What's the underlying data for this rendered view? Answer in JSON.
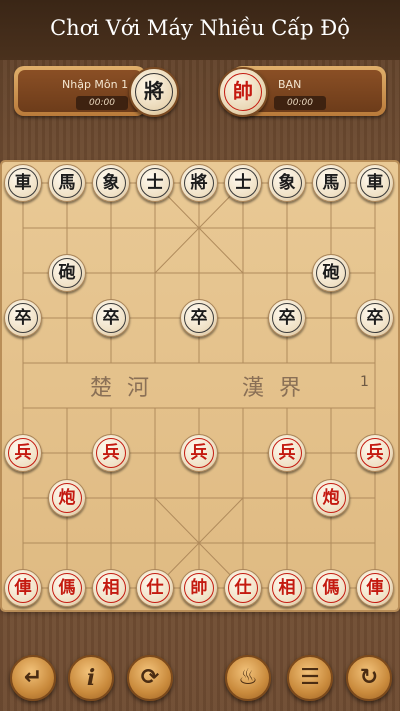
{
  "header": {
    "title": "Chơi Với Máy Nhiều Cấp Độ"
  },
  "opponent": {
    "name": "Nhập Môn 1",
    "time": "00:00",
    "general": "將"
  },
  "player": {
    "name": "BẠN",
    "time": "00:00",
    "general": "帥"
  },
  "board": {
    "river_left": "楚 河",
    "river_right": "漢 界",
    "river_number": "1",
    "pieces": [
      {
        "id": "b-rook-l",
        "ch": "車",
        "side": "black",
        "col": 0,
        "row": 0,
        "name": "black-chariot"
      },
      {
        "id": "b-horse-l",
        "ch": "馬",
        "side": "black",
        "col": 1,
        "row": 0,
        "name": "black-horse"
      },
      {
        "id": "b-ele-l",
        "ch": "象",
        "side": "black",
        "col": 2,
        "row": 0,
        "name": "black-elephant"
      },
      {
        "id": "b-adv-l",
        "ch": "士",
        "side": "black",
        "col": 3,
        "row": 0,
        "name": "black-advisor"
      },
      {
        "id": "b-gen",
        "ch": "將",
        "side": "black",
        "col": 4,
        "row": 0,
        "name": "black-general"
      },
      {
        "id": "b-adv-r",
        "ch": "士",
        "side": "black",
        "col": 5,
        "row": 0,
        "name": "black-advisor"
      },
      {
        "id": "b-ele-r",
        "ch": "象",
        "side": "black",
        "col": 6,
        "row": 0,
        "name": "black-elephant"
      },
      {
        "id": "b-horse-r",
        "ch": "馬",
        "side": "black",
        "col": 7,
        "row": 0,
        "name": "black-horse"
      },
      {
        "id": "b-rook-r",
        "ch": "車",
        "side": "black",
        "col": 8,
        "row": 0,
        "name": "black-chariot"
      },
      {
        "id": "b-can-l",
        "ch": "砲",
        "side": "black",
        "col": 1,
        "row": 2,
        "name": "black-cannon"
      },
      {
        "id": "b-can-r",
        "ch": "砲",
        "side": "black",
        "col": 7,
        "row": 2,
        "name": "black-cannon"
      },
      {
        "id": "b-sol-1",
        "ch": "卒",
        "side": "black",
        "col": 0,
        "row": 3,
        "name": "black-soldier"
      },
      {
        "id": "b-sol-2",
        "ch": "卒",
        "side": "black",
        "col": 2,
        "row": 3,
        "name": "black-soldier"
      },
      {
        "id": "b-sol-3",
        "ch": "卒",
        "side": "black",
        "col": 4,
        "row": 3,
        "name": "black-soldier"
      },
      {
        "id": "b-sol-4",
        "ch": "卒",
        "side": "black",
        "col": 6,
        "row": 3,
        "name": "black-soldier"
      },
      {
        "id": "b-sol-5",
        "ch": "卒",
        "side": "black",
        "col": 8,
        "row": 3,
        "name": "black-soldier"
      },
      {
        "id": "r-sol-1",
        "ch": "兵",
        "side": "red",
        "col": 0,
        "row": 6,
        "name": "red-soldier"
      },
      {
        "id": "r-sol-2",
        "ch": "兵",
        "side": "red",
        "col": 2,
        "row": 6,
        "name": "red-soldier"
      },
      {
        "id": "r-sol-3",
        "ch": "兵",
        "side": "red",
        "col": 4,
        "row": 6,
        "name": "red-soldier"
      },
      {
        "id": "r-sol-4",
        "ch": "兵",
        "side": "red",
        "col": 6,
        "row": 6,
        "name": "red-soldier"
      },
      {
        "id": "r-sol-5",
        "ch": "兵",
        "side": "red",
        "col": 8,
        "row": 6,
        "name": "red-soldier"
      },
      {
        "id": "r-can-l",
        "ch": "炮",
        "side": "red",
        "col": 1,
        "row": 7,
        "name": "red-cannon"
      },
      {
        "id": "r-can-r",
        "ch": "炮",
        "side": "red",
        "col": 7,
        "row": 7,
        "name": "red-cannon"
      },
      {
        "id": "r-rook-l",
        "ch": "俥",
        "side": "red",
        "col": 0,
        "row": 9,
        "name": "red-chariot"
      },
      {
        "id": "r-horse-l",
        "ch": "傌",
        "side": "red",
        "col": 1,
        "row": 9,
        "name": "red-horse"
      },
      {
        "id": "r-ele-l",
        "ch": "相",
        "side": "red",
        "col": 2,
        "row": 9,
        "name": "red-elephant"
      },
      {
        "id": "r-adv-l",
        "ch": "仕",
        "side": "red",
        "col": 3,
        "row": 9,
        "name": "red-advisor"
      },
      {
        "id": "r-gen",
        "ch": "帥",
        "side": "red",
        "col": 4,
        "row": 9,
        "name": "red-general"
      },
      {
        "id": "r-adv-r",
        "ch": "仕",
        "side": "red",
        "col": 5,
        "row": 9,
        "name": "red-advisor"
      },
      {
        "id": "r-ele-r",
        "ch": "相",
        "side": "red",
        "col": 6,
        "row": 9,
        "name": "red-elephant"
      },
      {
        "id": "r-horse-r",
        "ch": "傌",
        "side": "red",
        "col": 7,
        "row": 9,
        "name": "red-horse"
      },
      {
        "id": "r-rook-r",
        "ch": "俥",
        "side": "red",
        "col": 8,
        "row": 9,
        "name": "red-chariot"
      }
    ]
  },
  "toolbar": [
    {
      "name": "undo-button",
      "icon": "return-arrow-icon",
      "glyph": "↵"
    },
    {
      "name": "info-button",
      "icon": "info-icon",
      "glyph": "i"
    },
    {
      "name": "swap-sides-button",
      "icon": "rotate-arrows-icon",
      "glyph": "⟳"
    },
    {
      "name": "hint-button",
      "icon": "lightbulb-icon",
      "glyph": "♨"
    },
    {
      "name": "menu-button",
      "icon": "menu-lines-icon",
      "glyph": "☰"
    },
    {
      "name": "restart-button",
      "icon": "restart-icon",
      "glyph": "↻"
    }
  ],
  "colors": {
    "black_piece": "#1c1c1c",
    "red_piece": "#c41a10",
    "board": "#e3bf88",
    "grid": "#b08b5c"
  }
}
